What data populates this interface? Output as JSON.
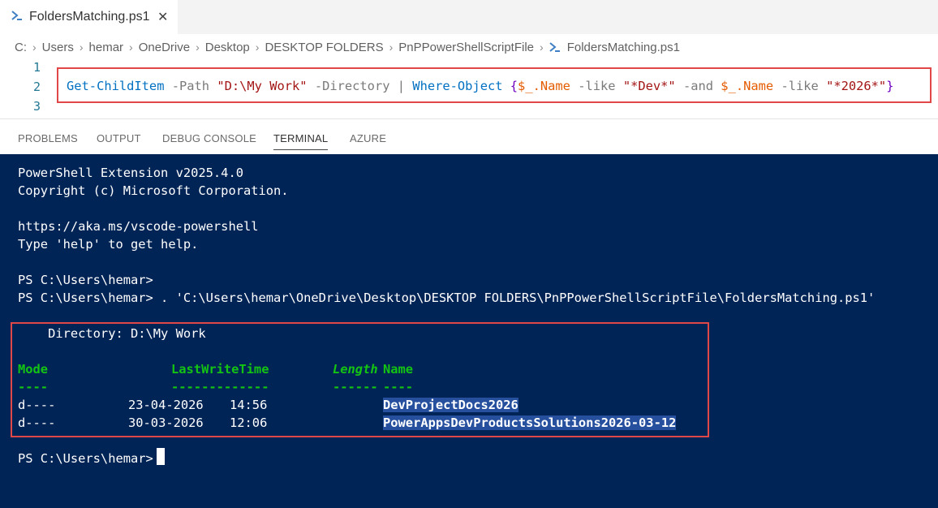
{
  "tab": {
    "icon": "powershell-icon",
    "label": "FoldersMatching.ps1",
    "close": "✕"
  },
  "breadcrumb": [
    "C:",
    "Users",
    "hemar",
    "OneDrive",
    "Desktop",
    "DESKTOP FOLDERS",
    "PnPPowerShellScriptFile",
    "FoldersMatching.ps1"
  ],
  "editor": {
    "line_numbers": [
      "1",
      "2",
      "3"
    ],
    "code": {
      "cmd1": "Get-ChildItem",
      "p1": " -Path ",
      "s1": "\"D:\\My Work\"",
      "p2": " -Directory ",
      "pipe": "|",
      "cmd2": " Where-Object ",
      "b1": "{",
      "v1": "$_",
      "v1b": ".Name",
      "p3": " -like ",
      "s2": "\"*Dev*\"",
      "p4": " -and ",
      "v2": "$_",
      "v2b": ".Name",
      "p5": " -like ",
      "s3": "\"*2026*\"",
      "b2": "}"
    }
  },
  "panel_tabs": [
    "PROBLEMS",
    "OUTPUT",
    "DEBUG CONSOLE",
    "TERMINAL",
    "AZURE"
  ],
  "terminal": {
    "l1": "PowerShell Extension v2025.4.0",
    "l2": "Copyright (c) Microsoft Corporation.",
    "l3": "https://aka.ms/vscode-powershell",
    "l4": "Type 'help' to get help.",
    "l5": "PS C:\\Users\\hemar>",
    "l6": "PS C:\\Users\\hemar> . 'C:\\Users\\hemar\\OneDrive\\Desktop\\DESKTOP FOLDERS\\PnPPowerShellScriptFile\\FoldersMatching.ps1'",
    "dir": "    Directory: D:\\My Work",
    "headers": {
      "mode": "Mode",
      "lwt": "LastWriteTime",
      "length": "Length",
      "name": "Name"
    },
    "underlines": {
      "mode": "----",
      "lwt": "-------------",
      "length": "------",
      "name": "----"
    },
    "rows": [
      {
        "mode": "d----",
        "date": "23-04-2026",
        "time": "14:56",
        "name": "DevProjectDocs2026"
      },
      {
        "mode": "d----",
        "date": "30-03-2026",
        "time": "12:06",
        "name": "PowerAppsDevProductsSolutions2026-03-12"
      }
    ],
    "prompt": "PS C:\\Users\\hemar>"
  }
}
